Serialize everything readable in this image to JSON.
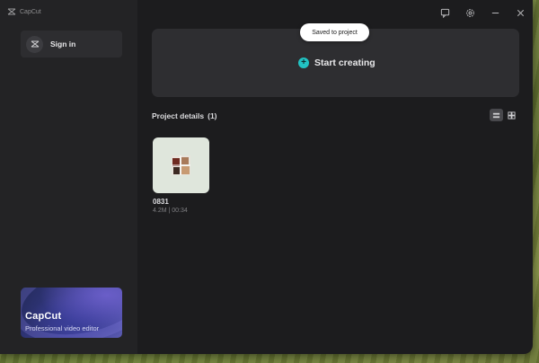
{
  "app": {
    "name": "CapCut"
  },
  "sidebar": {
    "signin_label": "Sign in",
    "promo": {
      "title": "CapCut",
      "subtitle": "Professional video editor"
    }
  },
  "titlebar": {
    "icons": [
      "feedback-icon",
      "settings-icon",
      "minimize-icon",
      "close-icon"
    ]
  },
  "hero": {
    "cta_label": "Start creating",
    "accent": "#22c3c3"
  },
  "toast": {
    "text": "Saved to project"
  },
  "projects": {
    "heading": "Project details",
    "count": "(1)",
    "items": [
      {
        "name": "0831",
        "meta": "4.2M | 00:34"
      }
    ]
  }
}
